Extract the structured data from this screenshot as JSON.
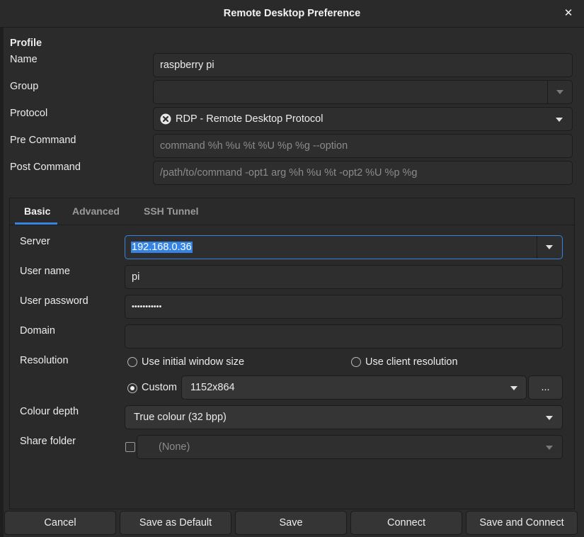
{
  "window": {
    "title": "Remote Desktop Preference"
  },
  "profile": {
    "section_title": "Profile",
    "name_label": "Name",
    "name_value": "raspberry pi",
    "group_label": "Group",
    "group_value": "",
    "protocol_label": "Protocol",
    "protocol_value": "RDP - Remote Desktop Protocol",
    "protocol_icon": "rdp-protocol-icon",
    "pre_command_label": "Pre Command",
    "pre_command_placeholder": "command %h %u %t %U %p %g --option",
    "post_command_label": "Post Command",
    "post_command_placeholder": "/path/to/command -opt1 arg %h %u %t -opt2 %U %p %g"
  },
  "tabs": [
    {
      "label": "Basic",
      "active": true
    },
    {
      "label": "Advanced",
      "active": false
    },
    {
      "label": "SSH Tunnel",
      "active": false
    }
  ],
  "basic": {
    "server_label": "Server",
    "server_value": "192.168.0.36",
    "username_label": "User name",
    "username_value": "pi",
    "password_label": "User password",
    "password_value": "•••••••••••",
    "domain_label": "Domain",
    "domain_value": "",
    "resolution_label": "Resolution",
    "resolution_options": {
      "initial": "Use initial window size",
      "client": "Use client resolution",
      "custom": "Custom"
    },
    "resolution_selected": "custom",
    "custom_resolution_value": "1152x864",
    "resolution_more_label": "...",
    "colour_depth_label": "Colour depth",
    "colour_depth_value": "True colour (32 bpp)",
    "share_folder_label": "Share folder",
    "share_folder_checked": false,
    "share_folder_value": "(None)"
  },
  "buttons": {
    "cancel": "Cancel",
    "save_default": "Save as Default",
    "save": "Save",
    "connect": "Connect",
    "save_connect": "Save and Connect"
  },
  "colors": {
    "accent": "#3584e4",
    "background": "#2b2b2b",
    "entry_background": "#2e2e2e"
  }
}
